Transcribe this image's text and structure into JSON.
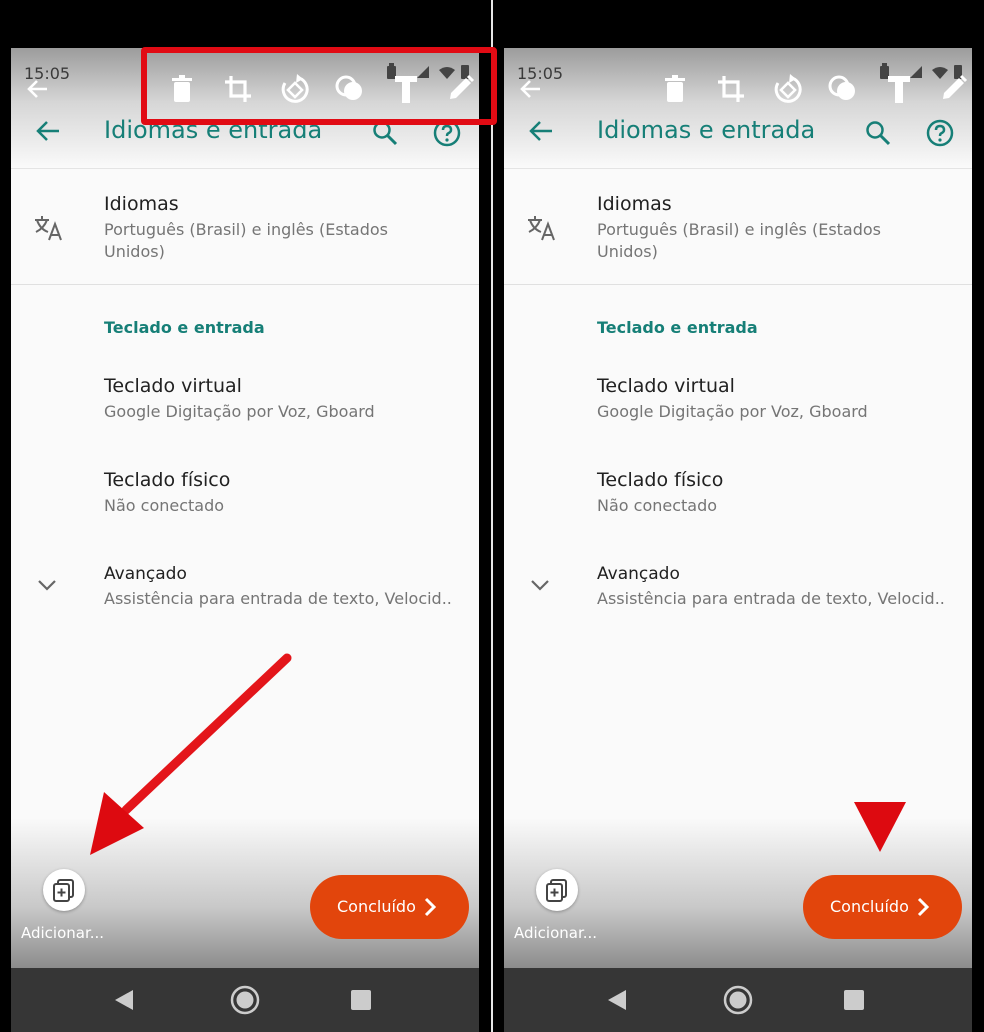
{
  "status_bar": {
    "time": "15:05"
  },
  "header": {
    "title": "Idiomas e entrada"
  },
  "languages_item": {
    "title": "Idiomas",
    "subtitle": "Português (Brasil) e inglês (Estados Unidos)"
  },
  "category": {
    "label": "Teclado e entrada"
  },
  "virtual_keyboard": {
    "title": "Teclado virtual",
    "subtitle": "Google Digitação por Voz, Gboard"
  },
  "physical_keyboard": {
    "title": "Teclado físico",
    "subtitle": "Não conectado"
  },
  "advanced": {
    "title": "Avançado",
    "subtitle": "Assistência para entrada de texto, Velocid.."
  },
  "screenshot_actions": {
    "add_label": "Adicionar...",
    "done_label": "Concluído"
  },
  "edit_toolbar": {
    "icons": [
      "back-arrow-icon",
      "delete-icon",
      "crop-icon",
      "rotate-icon",
      "shapes-icon",
      "text-icon",
      "pencil-icon"
    ]
  },
  "annotation_colors": {
    "highlight": "#e10b14",
    "done_button": "#e2450c",
    "accent": "#167f77"
  }
}
